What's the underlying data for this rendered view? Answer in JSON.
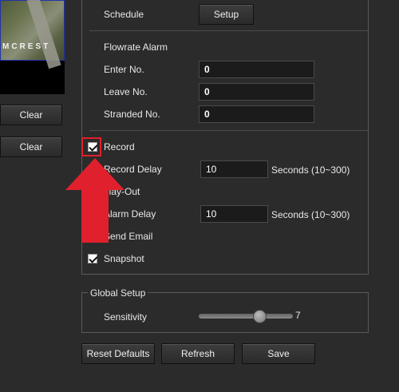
{
  "preview": {
    "brand_text": "MCREST"
  },
  "left_buttons": {
    "clear1": "Clear",
    "clear2": "Clear"
  },
  "schedule": {
    "label": "Schedule",
    "button": "Setup"
  },
  "flowrate": {
    "title": "Flowrate Alarm",
    "enter_label": "Enter No.",
    "enter_value": "0",
    "leave_label": "Leave No.",
    "leave_value": "0",
    "stranded_label": "Stranded No.",
    "stranded_value": "0"
  },
  "record": {
    "label": "Record",
    "checked": true
  },
  "record_delay": {
    "label": "Record Delay",
    "value": "10",
    "unit": "Seconds (10~300)"
  },
  "relay_out": {
    "label": "elay-Out"
  },
  "alarm_delay": {
    "label": "Alarm Delay",
    "value": "10",
    "unit": "Seconds (10~300)"
  },
  "send_email": {
    "label": "Send Email",
    "checked": false
  },
  "snapshot": {
    "label": "Snapshot",
    "checked": true
  },
  "global_setup": {
    "legend": "Global Setup",
    "sensitivity_label": "Sensitivity",
    "sensitivity_value": "7"
  },
  "footer": {
    "reset": "Reset Defaults",
    "refresh": "Refresh",
    "save": "Save"
  },
  "colors": {
    "highlight": "#e0202c",
    "background": "#2b2b2b"
  }
}
